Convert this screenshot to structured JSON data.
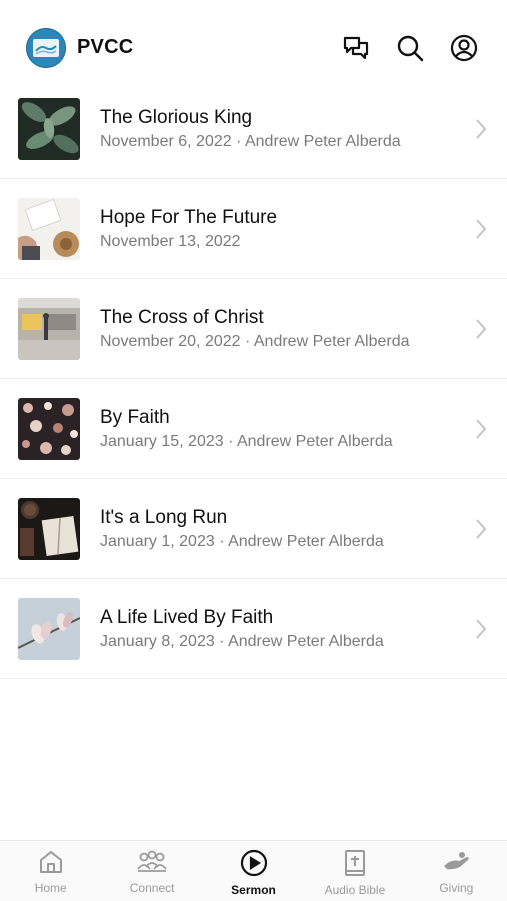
{
  "app": {
    "name": "PVCC"
  },
  "sermons": [
    {
      "title": "The Glorious King",
      "meta": "November 6, 2022 · Andrew Peter Alberda",
      "thumb": "leaves-thumbnail"
    },
    {
      "title": "Hope For The Future",
      "meta": "November 13, 2022",
      "thumb": "hat-bible-thumbnail"
    },
    {
      "title": "The Cross of Christ",
      "meta": "November 20, 2022 · Andrew Peter Alberda",
      "thumb": "train-thumbnail"
    },
    {
      "title": "By Faith",
      "meta": "January 15, 2023 · Andrew Peter Alberda",
      "thumb": "flowers-thumbnail"
    },
    {
      "title": "It's a Long Run",
      "meta": "January 1, 2023 · Andrew Peter Alberda",
      "thumb": "coffee-bible-thumbnail"
    },
    {
      "title": "A Life Lived By Faith",
      "meta": "January 8, 2023 · Andrew Peter Alberda",
      "thumb": "magnolia-thumbnail"
    }
  ],
  "tabs": [
    {
      "label": "Home",
      "icon": "home-icon"
    },
    {
      "label": "Connect",
      "icon": "people-icon"
    },
    {
      "label": "Sermon",
      "icon": "play-circle-icon"
    },
    {
      "label": "Audio Bible",
      "icon": "bible-icon"
    },
    {
      "label": "Giving",
      "icon": "hand-icon"
    }
  ],
  "active_tab": "Sermon"
}
